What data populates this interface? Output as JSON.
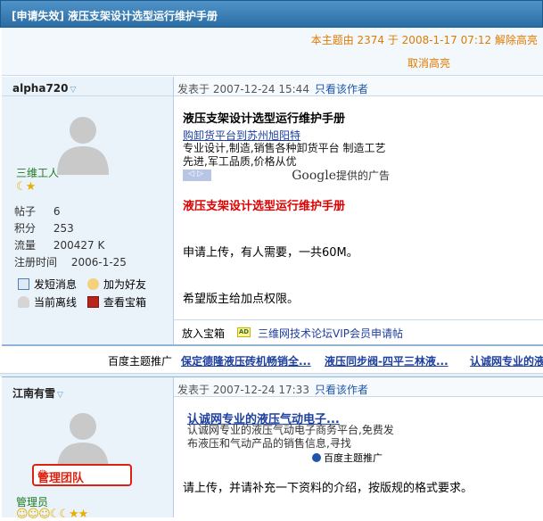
{
  "thread": {
    "title_tag": "[申请失效]",
    "title": "液压支架设计选型运行维护手册",
    "highlight_line": "本主题由 2374 于 2008-1-17 07:12 解除高亮",
    "cancel_highlight": "取消高亮"
  },
  "posts": [
    {
      "author": "alpha720",
      "rank": "三维工人",
      "stats": [
        {
          "k": "帖子",
          "v": "6"
        },
        {
          "k": "积分",
          "v": "253"
        },
        {
          "k": "流量",
          "v": "200427 K"
        },
        {
          "k": "注册时间",
          "v": "2006-1-25"
        }
      ],
      "actions": [
        "发短消息",
        "加为好友",
        "当前离线",
        "查看宝箱"
      ],
      "meta_date": "发表于 2007-12-24 15:44",
      "meta_link": "只看该作者",
      "post_title": "液压支架设计选型运行维护手册",
      "ad": {
        "link": "购卸货平台到苏州旭阳特",
        "text": "专业设计,制造,销售各种卸货平台 制造工艺先进,军工品质,价格从优",
        "google": "Google",
        "google_suffix": "提供的广告"
      },
      "red_title": "液压支架设计选型运行维护手册",
      "body_lines": [
        "申请上传，有人需要，一共60M。",
        "希望版主给加点权限。"
      ],
      "bottom_left": "放入宝箱",
      "bottom_badge": "AD",
      "bottom_link": "三维网技术论坛VIP会员申请帖"
    },
    {
      "author": "江南有雪",
      "rank": "管理员",
      "team_badge": "管理团队",
      "meta_date": "发表于 2007-12-24 17:33",
      "meta_link": "只看该作者",
      "ad": {
        "link": "认诚网专业的液压气动电子...",
        "text": "认诚网专业的液压气动电子商务平台,免费发布液压和气动产品的销售信息,寻找",
        "foot": "百度主题推广"
      },
      "body_lines": [
        "请上传，并请补充一下资料的介绍，按版规的格式要求。"
      ]
    }
  ],
  "promo": {
    "label": "百度主题推广",
    "links": [
      "保定德隆液压砖机畅销全...",
      "液压同步阀-四平三林液...",
      "认诚网专业的液"
    ]
  }
}
